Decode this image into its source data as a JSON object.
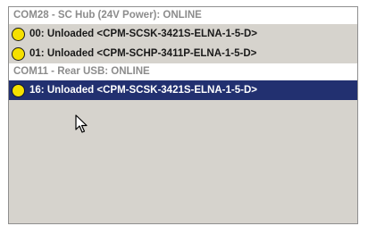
{
  "device_tree": {
    "groups": [
      {
        "header": "COM28 - SC Hub (24V Power): ONLINE",
        "devices": [
          {
            "label": "00: Unloaded <CPM-SCSK-3421S-ELNA-1-5-D>",
            "status_icon": "yellow-circle-icon",
            "selected": false
          },
          {
            "label": "01: Unloaded <CPM-SCHP-3411P-ELNA-1-5-D>",
            "status_icon": "yellow-circle-icon",
            "selected": false
          }
        ]
      },
      {
        "header": "COM11 - Rear USB: ONLINE",
        "devices": [
          {
            "label": "16: Unloaded <CPM-SCSK-3421S-ELNA-1-5-D>",
            "status_icon": "yellow-circle-icon",
            "selected": true
          }
        ]
      }
    ]
  },
  "colors": {
    "selection_bg": "#223070",
    "status_yellow": "#f5e000",
    "header_text": "#8c8c8c",
    "panel_bg": "#d6d3cd"
  }
}
